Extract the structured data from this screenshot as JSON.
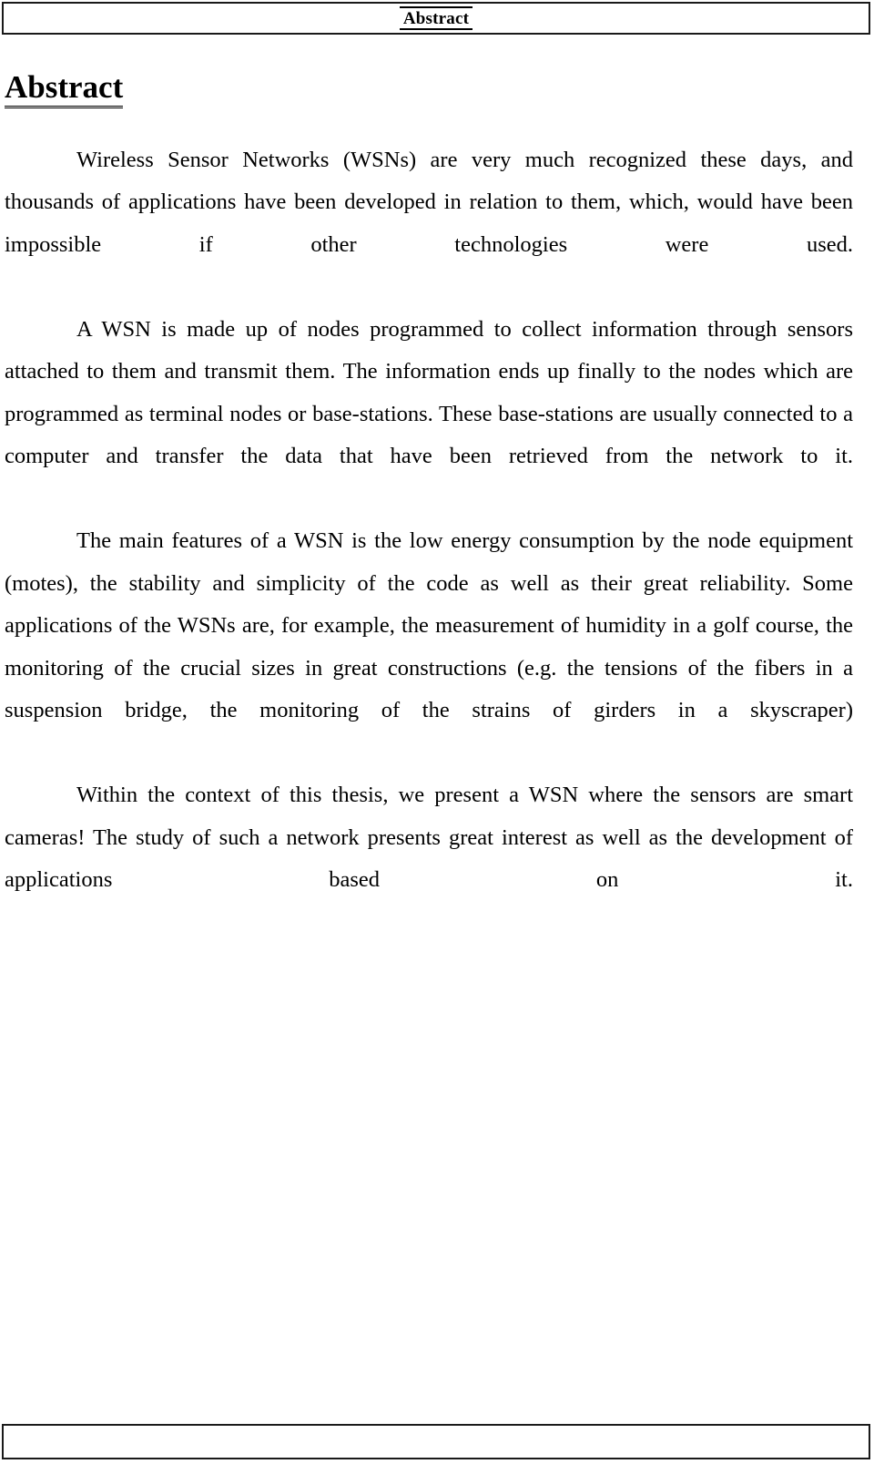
{
  "document": {
    "running_header": {
      "title": "Abstract"
    },
    "section": {
      "heading": "Abstract"
    },
    "paragraphs": [
      {
        "id": "par-1",
        "text": "Wireless Sensor Networks (WSNs) are very much recognized these days, and thousands of applications have been developed in relation to them, which, would have been impossible if other technologies were used."
      },
      {
        "id": "par-2",
        "text": "A WSN is made up of nodes programmed to collect information through sensors attached to them and transmit them. The information ends up finally to the nodes which are programmed as terminal nodes or base-stations. These base-stations are usually connected to a computer and transfer the data that have been retrieved from the network to it."
      },
      {
        "id": "par-3",
        "text": "The main features of a WSN is the low energy consumption by the node equipment (motes), the stability and simplicity of the code as well as their great reliability. Some applications of the WSNs are, for example, the measurement of humidity in a golf course, the monitoring of the crucial sizes in great constructions (e.g. the tensions of the fibers in a suspension bridge, the monitoring of the strains of girders in a skyscraper)"
      },
      {
        "id": "par-4",
        "text": "Within the context of this thesis, we present a WSN where the sensors are smart cameras! The study of such a network presents great interest as well as the development of applications based on it."
      }
    ],
    "running_footer": {
      "text": ""
    },
    "colors": {
      "text": "#000000",
      "page_background": "#ffffff",
      "border": "#1a1a1a"
    }
  }
}
